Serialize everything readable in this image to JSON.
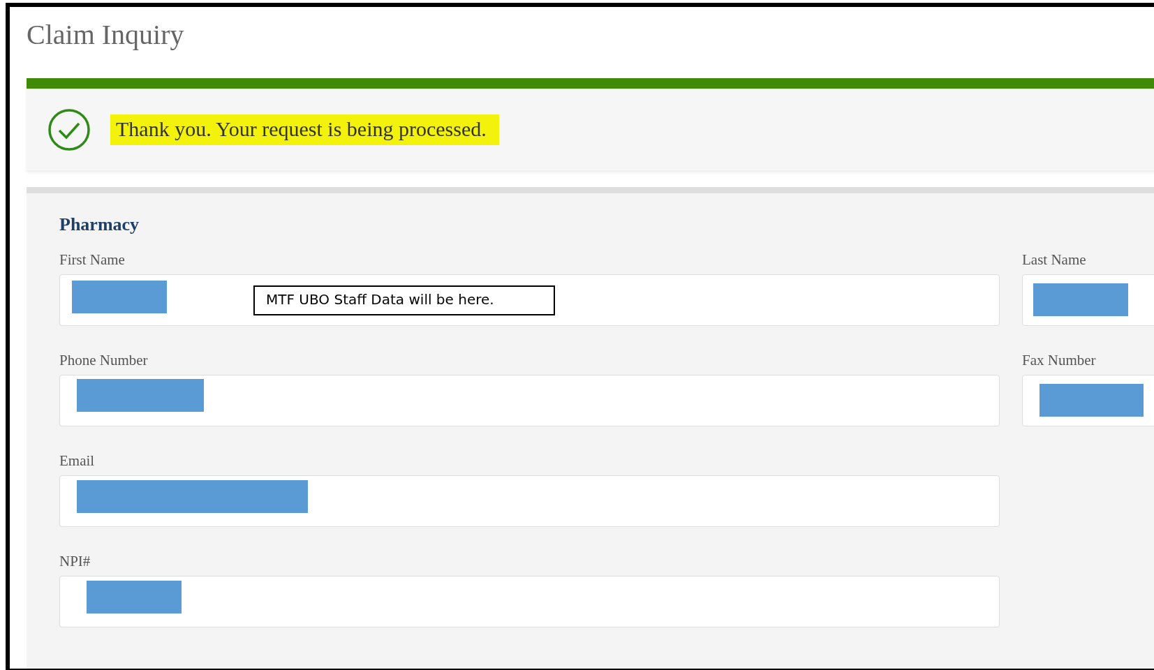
{
  "page": {
    "title": "Claim Inquiry"
  },
  "alert": {
    "kind": "success",
    "message": "Thank you. Your request is being processed.",
    "highlighted": true
  },
  "section": {
    "title": "Pharmacy",
    "left_fields": [
      {
        "label": "First Name",
        "redacted": true,
        "note": "MTF UBO Staff Data will be here."
      },
      {
        "label": "Phone Number",
        "redacted": true
      },
      {
        "label": "Email",
        "redacted": true
      },
      {
        "label": "NPI#",
        "redacted": true
      }
    ],
    "right_fields": [
      {
        "label": "Last Name",
        "redacted": true
      },
      {
        "label": "Fax Number",
        "redacted": true
      }
    ]
  }
}
